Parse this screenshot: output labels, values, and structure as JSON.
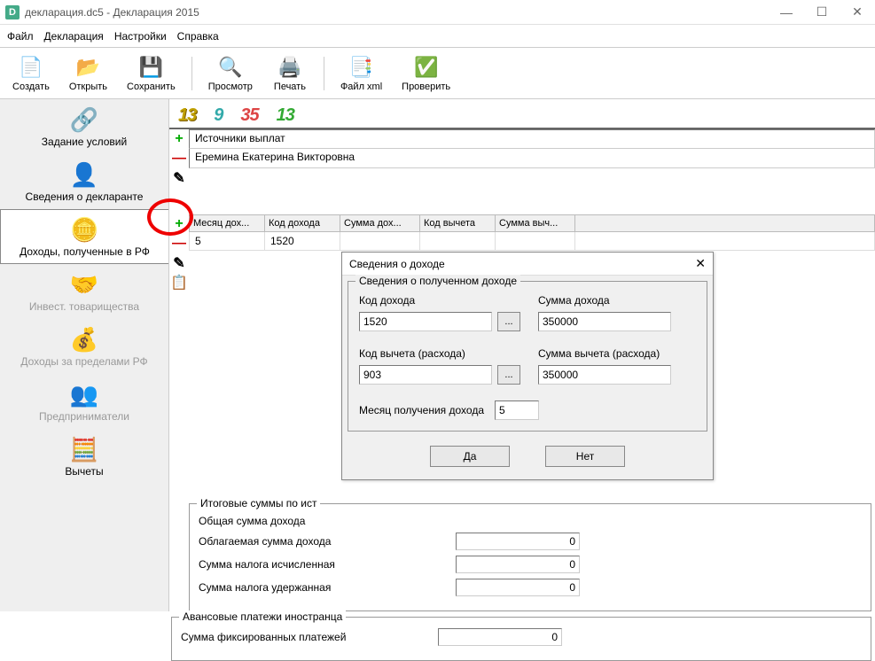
{
  "window": {
    "title": "декларация.dc5 - Декларация 2015",
    "app_icon_letter": "D"
  },
  "menubar": {
    "file": "Файл",
    "declaration": "Декларация",
    "settings": "Настройки",
    "help": "Справка"
  },
  "toolbar": {
    "create": "Создать",
    "open": "Открыть",
    "save": "Сохранить",
    "preview": "Просмотр",
    "print": "Печать",
    "xml": "Файл xml",
    "check": "Проверить"
  },
  "sidebar": {
    "items": [
      {
        "label": "Задание условий"
      },
      {
        "label": "Сведения о декларанте"
      },
      {
        "label": "Доходы, полученные в РФ"
      },
      {
        "label": "Инвест. товарищества"
      },
      {
        "label": "Доходы за пределами РФ"
      },
      {
        "label": "Предприниматели"
      },
      {
        "label": "Вычеты"
      }
    ]
  },
  "rates": {
    "r1": "13",
    "r2": "9",
    "r3": "35",
    "r4": "13"
  },
  "sources": {
    "header": "Источники выплат",
    "row1": "Еремина Екатерина Викторовна"
  },
  "income_table": {
    "columns": {
      "month": "Месяц дох...",
      "code": "Код дохода",
      "sum": "Сумма дох...",
      "ded_code": "Код вычета",
      "ded_sum": "Сумма выч..."
    },
    "row": {
      "month": "5",
      "code": "1520"
    }
  },
  "dialog": {
    "title": "Сведения о доходе",
    "group_legend": "Сведения о полученном доходе",
    "income_code_label": "Код дохода",
    "income_code": "1520",
    "income_sum_label": "Сумма дохода",
    "income_sum": "350000",
    "ded_code_label": "Код вычета (расхода)",
    "ded_code": "903",
    "ded_sum_label": "Сумма вычета (расхода)",
    "ded_sum": "350000",
    "month_label": "Месяц получения дохода",
    "month": "5",
    "ok": "Да",
    "cancel": "Нет",
    "browse": "..."
  },
  "totals": {
    "legend": "Итоговые суммы по ист",
    "total_income_label": "Общая сумма дохода",
    "taxable_label": "Облагаемая сумма дохода",
    "taxable": "0",
    "tax_calc_label": "Сумма налога исчисленная",
    "tax_calc": "0",
    "tax_withheld_label": "Сумма налога удержанная",
    "tax_withheld": "0"
  },
  "advance": {
    "legend": "Авансовые платежи иностранца",
    "fixed_label": "Сумма фиксированных платежей",
    "fixed": "0"
  }
}
